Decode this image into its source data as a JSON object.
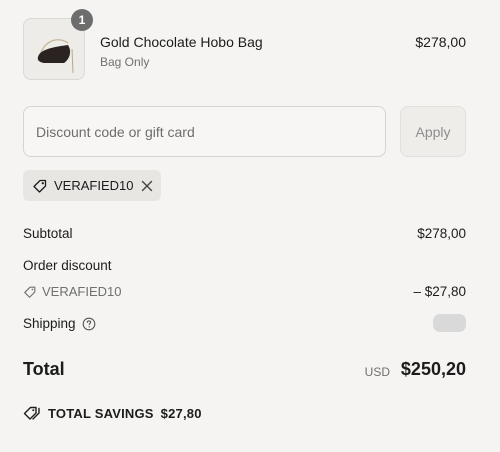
{
  "product": {
    "quantity": "1",
    "name": "Gold Chocolate Hobo Bag",
    "variant": "Bag Only",
    "price": "$278,00"
  },
  "discount": {
    "placeholder": "Discount code or gift card",
    "apply_label": "Apply",
    "applied_code": "VERAFIED10"
  },
  "summary": {
    "subtotal_label": "Subtotal",
    "subtotal_value": "$278,00",
    "order_discount_label": "Order discount",
    "discount_code": "VERAFIED10",
    "discount_value": "– $27,80",
    "shipping_label": "Shipping",
    "total_label": "Total",
    "currency": "USD",
    "total_value": "$250,20",
    "savings_label": "TOTAL SAVINGS",
    "savings_value": "$27,80"
  }
}
